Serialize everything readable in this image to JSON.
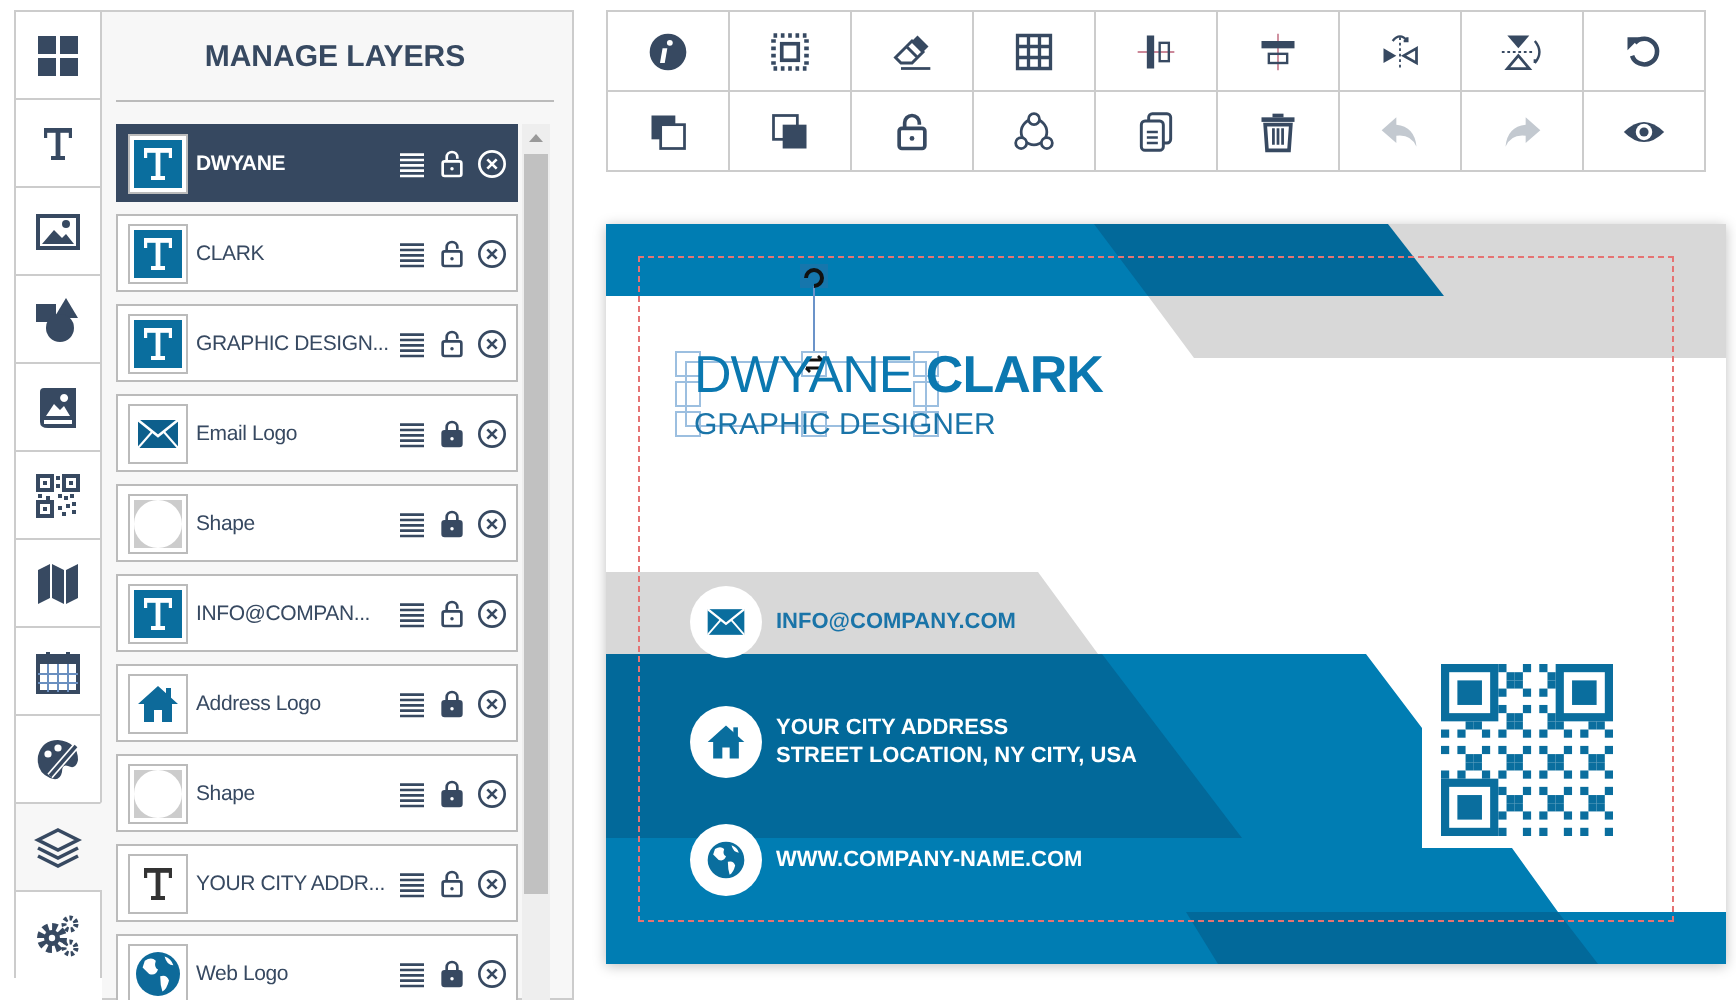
{
  "rail": [
    {
      "kind": "templates",
      "selected": false
    },
    {
      "kind": "text",
      "selected": false
    },
    {
      "kind": "image",
      "selected": false
    },
    {
      "kind": "shapes",
      "selected": false
    },
    {
      "kind": "album",
      "selected": false
    },
    {
      "kind": "qr",
      "selected": false
    },
    {
      "kind": "map",
      "selected": false
    },
    {
      "kind": "calendar",
      "selected": false
    },
    {
      "kind": "palette",
      "selected": false
    },
    {
      "kind": "layers",
      "selected": true
    },
    {
      "kind": "settings",
      "selected": false
    }
  ],
  "panel": {
    "title": "MANAGE LAYERS",
    "layers": [
      {
        "label": "DWYANE",
        "kind": "text-filled",
        "locked": false,
        "selected": true
      },
      {
        "label": "CLARK",
        "kind": "text-filled",
        "locked": false,
        "selected": false
      },
      {
        "label": "GRAPHIC DESIGN...",
        "kind": "text-filled",
        "locked": false,
        "selected": false
      },
      {
        "label": "Email Logo",
        "kind": "envelope",
        "locked": true,
        "selected": false
      },
      {
        "label": "Shape",
        "kind": "shape",
        "locked": true,
        "selected": false
      },
      {
        "label": "INFO@COMPAN...",
        "kind": "text-filled",
        "locked": false,
        "selected": false
      },
      {
        "label": "Address Logo",
        "kind": "house",
        "locked": true,
        "selected": false
      },
      {
        "label": "Shape",
        "kind": "shape",
        "locked": true,
        "selected": false
      },
      {
        "label": "YOUR CITY ADDR...",
        "kind": "text-plain",
        "locked": false,
        "selected": false
      },
      {
        "label": "Web Logo",
        "kind": "globe",
        "locked": true,
        "selected": false
      }
    ]
  },
  "toolbar": [
    {
      "kind": "info",
      "disabled": false
    },
    {
      "kind": "select",
      "disabled": false
    },
    {
      "kind": "eraser",
      "disabled": false
    },
    {
      "kind": "grid",
      "disabled": false
    },
    {
      "kind": "align-v",
      "disabled": false
    },
    {
      "kind": "align-h",
      "disabled": false
    },
    {
      "kind": "flip-h",
      "disabled": false
    },
    {
      "kind": "flip-v",
      "disabled": false
    },
    {
      "kind": "reset",
      "disabled": false
    },
    {
      "kind": "front",
      "disabled": false
    },
    {
      "kind": "back",
      "disabled": false
    },
    {
      "kind": "unlock",
      "disabled": false
    },
    {
      "kind": "nodes",
      "disabled": false
    },
    {
      "kind": "copy",
      "disabled": false
    },
    {
      "kind": "trash",
      "disabled": false
    },
    {
      "kind": "undo",
      "disabled": true
    },
    {
      "kind": "redo",
      "disabled": true
    },
    {
      "kind": "eye",
      "disabled": false
    }
  ],
  "card": {
    "name": "DWYANE **CLARK**",
    "title": "GRAPHIC DESIGNER",
    "contacts": [
      {
        "kind": "email",
        "lines": [
          "INFO@COMPANY.COM"
        ]
      },
      {
        "kind": "address",
        "lines": [
          "YOUR CITY ADDRESS",
          "STREET LOCATION, NY CITY, USA"
        ]
      },
      {
        "kind": "web",
        "lines": [
          "WWW.COMPANY-NAME.COM"
        ]
      }
    ]
  }
}
